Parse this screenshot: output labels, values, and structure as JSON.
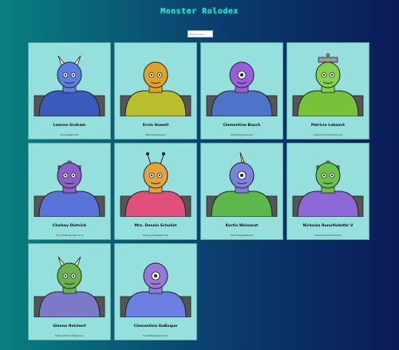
{
  "app": {
    "title": "Monster Rolodex"
  },
  "search": {
    "placeholder": "search monsters"
  },
  "monsters": [
    {
      "name": "Leanne Graham",
      "email": "Sincere@april.biz",
      "color": "#5b7fe0",
      "accent": "#3a5bbd",
      "head": "horns"
    },
    {
      "name": "Ervin Howell",
      "email": "Shanna@melissa.tv",
      "color": "#e1a22a",
      "accent": "#b7c02c",
      "head": "round"
    },
    {
      "name": "Clementine Bauch",
      "email": "Nathan@yesenia.net",
      "color": "#9b5de0",
      "accent": "#4e74c9",
      "head": "cyclops"
    },
    {
      "name": "Patricia Lebsack",
      "email": "Julianne.OConner@kory.org",
      "color": "#86d14a",
      "accent": "#77c23a",
      "head": "robot"
    },
    {
      "name": "Chelsey Dietrich",
      "email": "Lucio_Hettinger@annie.ca",
      "color": "#8b5ec9",
      "accent": "#5a73d8",
      "head": "helmet"
    },
    {
      "name": "Mrs. Dennis Schulist",
      "email": "Karley_Dach@jasper.info",
      "color": "#e6a33a",
      "accent": "#e0507a",
      "head": "antenna"
    },
    {
      "name": "Kurtis Weissnat",
      "email": "Telly.Hoeger@billy.biz",
      "color": "#7a82e0",
      "accent": "#5cb84a",
      "head": "unicorn"
    },
    {
      "name": "Nicholas Runolfsdottir V",
      "email": "Sherwood@rosamond.me",
      "color": "#6bc24a",
      "accent": "#8f68d8",
      "head": "helmet"
    },
    {
      "name": "Glenna Reichert",
      "email": "Chaim_McDermott@dana.io",
      "color": "#6ab24a",
      "accent": "#7a7ac8",
      "head": "horns"
    },
    {
      "name": "Clementina DuBuque",
      "email": "Rey.Padberg@karina.biz",
      "color": "#9a78d8",
      "accent": "#6a7fe0",
      "head": "cyclops"
    }
  ]
}
